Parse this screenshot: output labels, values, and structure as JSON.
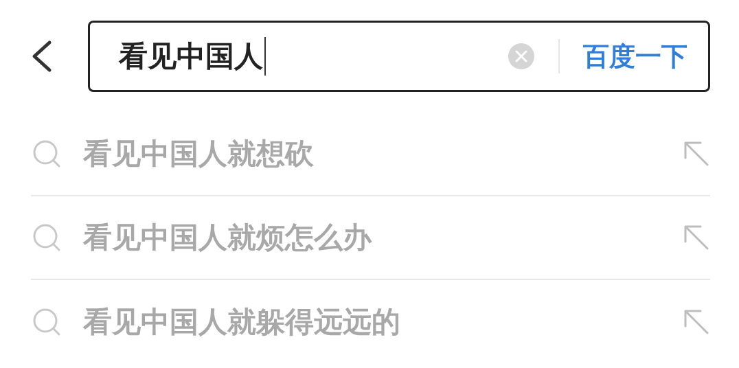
{
  "search": {
    "value": "看见中国人",
    "submit": "百度一下"
  },
  "suggestions": [
    {
      "text": "看见中国人**就想砍**"
    },
    {
      "text": "看见中国人**就烦怎么办**"
    },
    {
      "text": "看见中国人**就躲得远远的**"
    }
  ]
}
